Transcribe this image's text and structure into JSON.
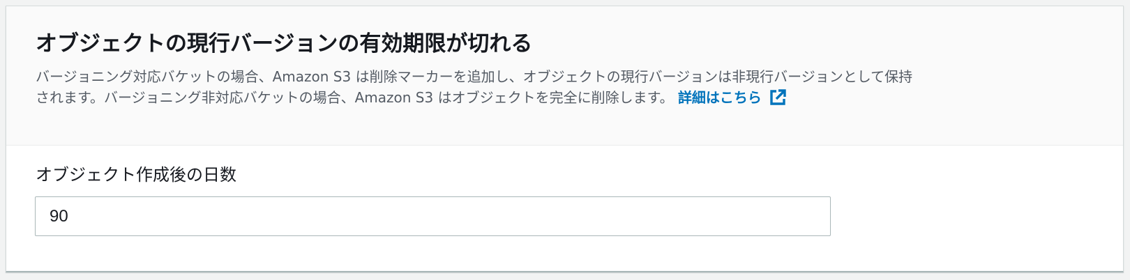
{
  "section": {
    "title": "オブジェクトの現行バージョンの有効期限が切れる",
    "description_line1": "バージョニング対応バケットの場合、Amazon S3 は削除マーカーを追加し、オブジェクトの現行バージョンは非現行バージョンとして保持",
    "description_line2": "されます。バージョニング非対応バケットの場合、Amazon S3 はオブジェクトを完全に削除します。",
    "learn_more_label": "詳細はこちら",
    "link_icon": "external-link-icon"
  },
  "field": {
    "label": "オブジェクト作成後の日数",
    "value": "90"
  },
  "colors": {
    "link": "#0073bb",
    "header_bg": "#fafafa",
    "title_text": "#16191f",
    "desc_text": "#545b64"
  }
}
